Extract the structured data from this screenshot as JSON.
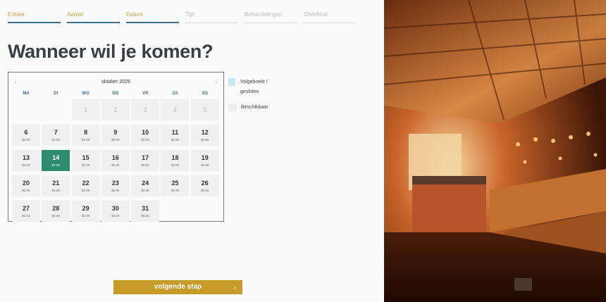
{
  "steps": [
    {
      "label": "Entree",
      "state": "done"
    },
    {
      "label": "Aantal",
      "state": "done"
    },
    {
      "label": "Datum",
      "state": "done"
    },
    {
      "label": "Tijd",
      "state": "pending"
    },
    {
      "label": "Behandelingen",
      "state": "pending"
    },
    {
      "label": "Checkout",
      "state": "pending"
    }
  ],
  "title": "Wanneer wil je komen?",
  "calendar": {
    "prev": "‹",
    "next": "›",
    "month": "oktober 2025",
    "weekdays": [
      "MA",
      "DI",
      "WO",
      "DO",
      "VR",
      "ZA",
      "ZO"
    ],
    "leading_empty": 2,
    "days": [
      {
        "d": "1",
        "p": "",
        "state": "closed"
      },
      {
        "d": "2",
        "p": "",
        "state": "closed"
      },
      {
        "d": "3",
        "p": "",
        "state": "closed"
      },
      {
        "d": "4",
        "p": "",
        "state": "closed"
      },
      {
        "d": "5",
        "p": "",
        "state": "closed"
      },
      {
        "d": "6",
        "p": "$2.00",
        "state": "available"
      },
      {
        "d": "7",
        "p": "$2.00",
        "state": "available"
      },
      {
        "d": "8",
        "p": "$2.00",
        "state": "available"
      },
      {
        "d": "9",
        "p": "$2.00",
        "state": "available"
      },
      {
        "d": "10",
        "p": "$4.50",
        "state": "available"
      },
      {
        "d": "11",
        "p": "$4.50",
        "state": "available"
      },
      {
        "d": "12",
        "p": "$4.50",
        "state": "available"
      },
      {
        "d": "13",
        "p": "$2.00",
        "state": "available"
      },
      {
        "d": "14",
        "p": "$2.00",
        "state": "selected"
      },
      {
        "d": "15",
        "p": "$2.00",
        "state": "available"
      },
      {
        "d": "16",
        "p": "$2.00",
        "state": "available"
      },
      {
        "d": "17",
        "p": "$4.50",
        "state": "available"
      },
      {
        "d": "18",
        "p": "$4.50",
        "state": "available"
      },
      {
        "d": "19",
        "p": "$4.50",
        "state": "available"
      },
      {
        "d": "20",
        "p": "$2.00",
        "state": "available"
      },
      {
        "d": "21",
        "p": "$2.00",
        "state": "available"
      },
      {
        "d": "22",
        "p": "$2.00",
        "state": "available"
      },
      {
        "d": "23",
        "p": "$2.00",
        "state": "available"
      },
      {
        "d": "24",
        "p": "$4.50",
        "state": "available"
      },
      {
        "d": "25",
        "p": "$4.50",
        "state": "available"
      },
      {
        "d": "26",
        "p": "$4.50",
        "state": "available"
      },
      {
        "d": "27",
        "p": "$2.00",
        "state": "available"
      },
      {
        "d": "28",
        "p": "$2.00",
        "state": "available"
      },
      {
        "d": "29",
        "p": "$2.00",
        "state": "available"
      },
      {
        "d": "30",
        "p": "$2.00",
        "state": "available"
      },
      {
        "d": "31",
        "p": "$4.50",
        "state": "available"
      }
    ]
  },
  "legend": {
    "booked": "Volgeboekt / gesloten",
    "available": "Beschikbaar"
  },
  "button": {
    "label": "volgende stap",
    "chevron": "›"
  },
  "colors": {
    "accent_gold": "#c79b2a",
    "selected_green": "#2e8b6e",
    "step_underline": "#3f6f8f",
    "booked_swatch": "#cde6f6"
  },
  "photo": {
    "icon": "sauna-photo"
  }
}
